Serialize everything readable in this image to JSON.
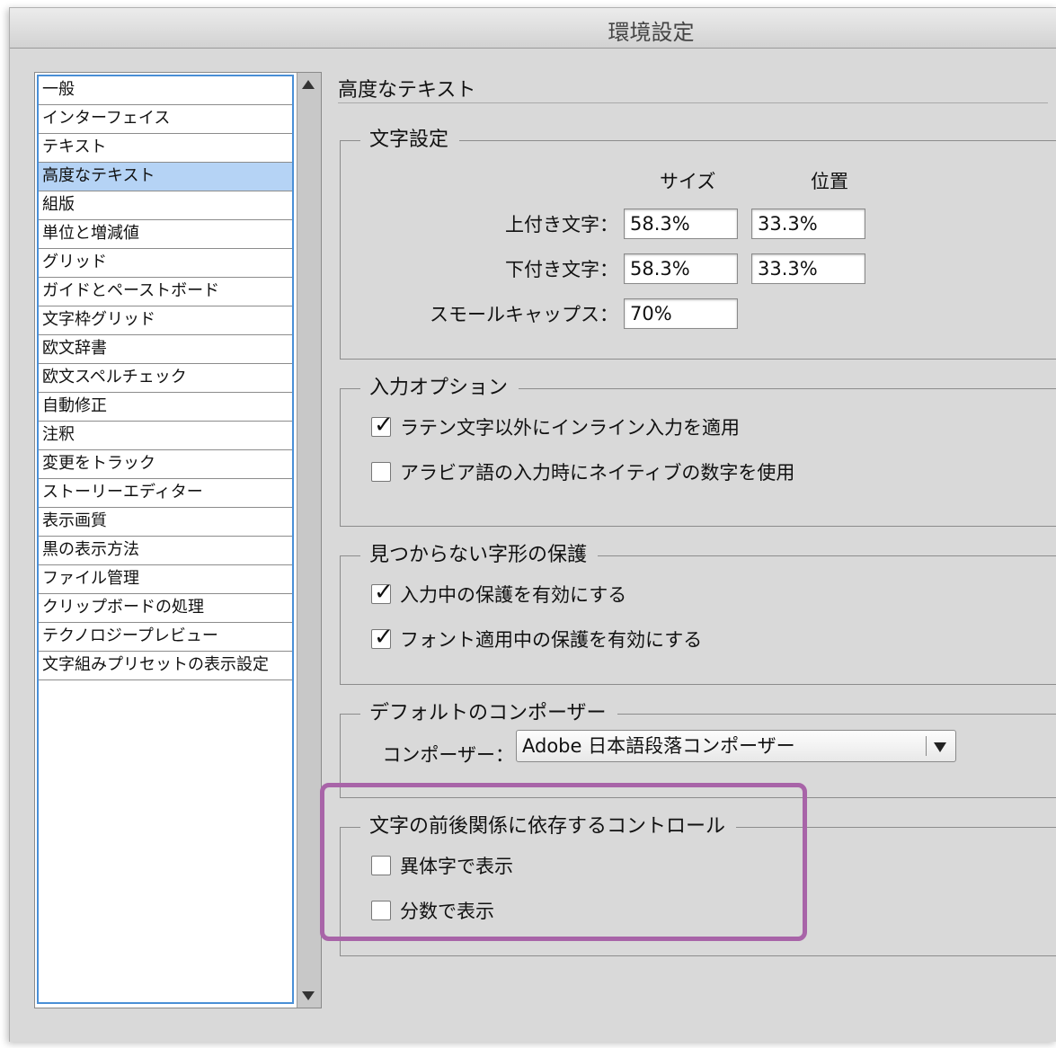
{
  "window": {
    "title": "環境設定"
  },
  "sidebar": {
    "items": [
      {
        "label": "一般"
      },
      {
        "label": "インターフェイス"
      },
      {
        "label": "テキスト"
      },
      {
        "label": "高度なテキスト",
        "selected": true
      },
      {
        "label": "組版"
      },
      {
        "label": "単位と増減値"
      },
      {
        "label": "グリッド"
      },
      {
        "label": "ガイドとペーストボード"
      },
      {
        "label": "文字枠グリッド"
      },
      {
        "label": "欧文辞書"
      },
      {
        "label": "欧文スペルチェック"
      },
      {
        "label": "自動修正"
      },
      {
        "label": "注釈"
      },
      {
        "label": "変更をトラック"
      },
      {
        "label": "ストーリーエディター"
      },
      {
        "label": "表示画質"
      },
      {
        "label": "黒の表示方法"
      },
      {
        "label": "ファイル管理"
      },
      {
        "label": "クリップボードの処理"
      },
      {
        "label": "テクノロジープレビュー"
      },
      {
        "label": "文字組みプリセットの表示設定"
      }
    ]
  },
  "panel": {
    "title": "高度なテキスト",
    "char_settings": {
      "legend": "文字設定",
      "col_size": "サイズ",
      "col_position": "位置",
      "superscript_label": "上付き文字：",
      "superscript_size": "58.3%",
      "superscript_position": "33.3%",
      "subscript_label": "下付き文字：",
      "subscript_size": "58.3%",
      "subscript_position": "33.3%",
      "smallcaps_label": "スモールキャップス：",
      "smallcaps_size": "70%"
    },
    "input_options": {
      "legend": "入力オプション",
      "opt1_label": "ラテン文字以外にインライン入力を適用",
      "opt1_checked": true,
      "opt2_label": "アラビア語の入力時にネイティブの数字を使用",
      "opt2_checked": false
    },
    "missing_glyph": {
      "legend": "見つからない字形の保護",
      "opt1_label": "入力中の保護を有効にする",
      "opt1_checked": true,
      "opt2_label": "フォント適用中の保護を有効にする",
      "opt2_checked": true
    },
    "default_composer": {
      "legend": "デフォルトのコンポーザー",
      "composer_label": "コンポーザー：",
      "composer_value": "Adobe 日本語段落コンポーザー"
    },
    "contextual_controls": {
      "legend": "文字の前後関係に依存するコントロール",
      "opt1_label": "異体字で表示",
      "opt1_checked": false,
      "opt2_label": "分数で表示",
      "opt2_checked": false
    }
  },
  "colors": {
    "selection": "#b5d3f5",
    "focus_ring": "#4a8fd6",
    "highlight": "#a864a8"
  }
}
